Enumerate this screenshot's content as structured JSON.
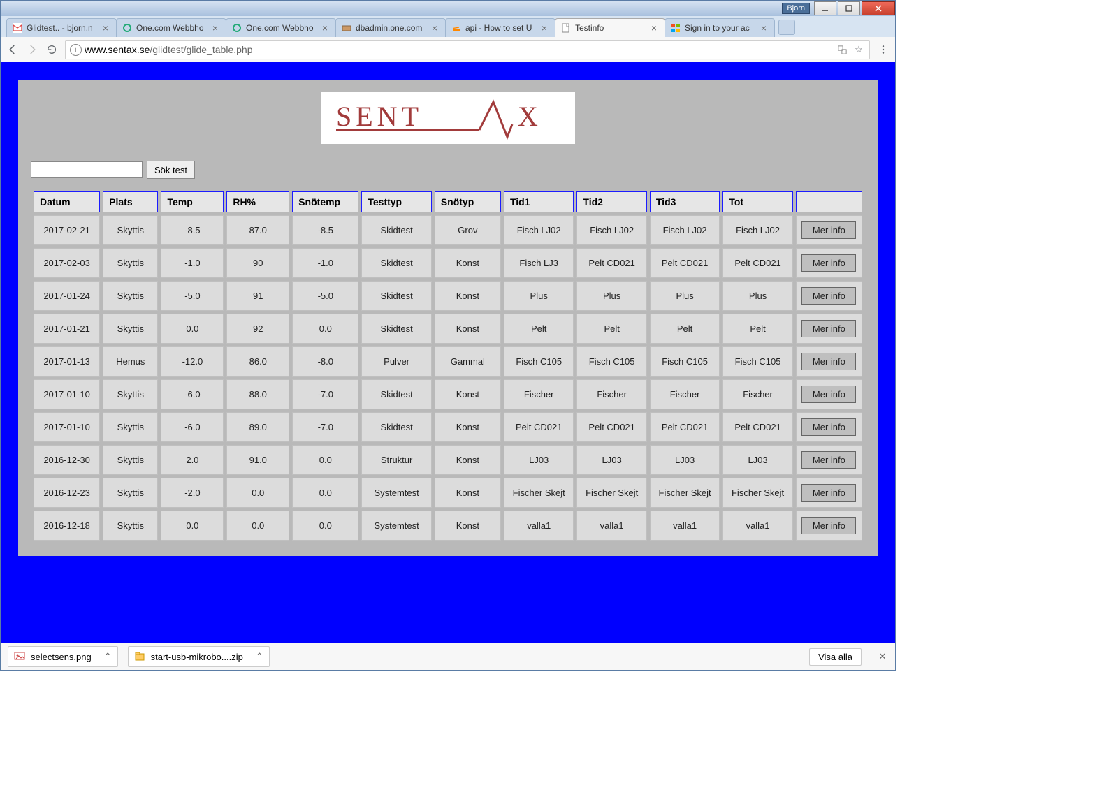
{
  "window": {
    "user_badge": "Bjorn"
  },
  "tabs": [
    {
      "label": "Glidtest.. - bjorn.n",
      "favicon": "gmail"
    },
    {
      "label": "One.com Webbho",
      "favicon": "one"
    },
    {
      "label": "One.com Webbho",
      "favicon": "one"
    },
    {
      "label": "dbadmin.one.com",
      "favicon": "pma"
    },
    {
      "label": "api - How to set U",
      "favicon": "so"
    },
    {
      "label": "Testinfo",
      "favicon": "page",
      "active": true
    },
    {
      "label": "Sign in to your ac",
      "favicon": "ms"
    }
  ],
  "address": {
    "host": "www.sentax.se",
    "path": "/glidtest/glide_table.php"
  },
  "page": {
    "logo_text": "SENTAX",
    "search_placeholder": "",
    "search_button": "Sök test",
    "more_button": "Mer info",
    "headers": [
      "Datum",
      "Plats",
      "Temp",
      "RH%",
      "Snötemp",
      "Testtyp",
      "Snötyp",
      "Tid1",
      "Tid2",
      "Tid3",
      "Tot",
      ""
    ],
    "rows": [
      {
        "datum": "2017-02-21",
        "plats": "Skyttis",
        "temp": "-8.5",
        "rh": "87.0",
        "snotemp": "-8.5",
        "testtyp": "Skidtest",
        "snotyp": "Grov",
        "t1": "Fisch LJ02",
        "t2": "Fisch LJ02",
        "t3": "Fisch LJ02",
        "tot": "Fisch LJ02"
      },
      {
        "datum": "2017-02-03",
        "plats": "Skyttis",
        "temp": "-1.0",
        "rh": "90",
        "snotemp": "-1.0",
        "testtyp": "Skidtest",
        "snotyp": "Konst",
        "t1": "Fisch LJ3",
        "t2": "Pelt CD021",
        "t3": "Pelt CD021",
        "tot": "Pelt CD021"
      },
      {
        "datum": "2017-01-24",
        "plats": "Skyttis",
        "temp": "-5.0",
        "rh": "91",
        "snotemp": "-5.0",
        "testtyp": "Skidtest",
        "snotyp": "Konst",
        "t1": "Plus",
        "t2": "Plus",
        "t3": "Plus",
        "tot": "Plus"
      },
      {
        "datum": "2017-01-21",
        "plats": "Skyttis",
        "temp": "0.0",
        "rh": "92",
        "snotemp": "0.0",
        "testtyp": "Skidtest",
        "snotyp": "Konst",
        "t1": "Pelt",
        "t2": "Pelt",
        "t3": "Pelt",
        "tot": "Pelt"
      },
      {
        "datum": "2017-01-13",
        "plats": "Hemus",
        "temp": "-12.0",
        "rh": "86.0",
        "snotemp": "-8.0",
        "testtyp": "Pulver",
        "snotyp": "Gammal",
        "t1": "Fisch C105",
        "t2": "Fisch C105",
        "t3": "Fisch C105",
        "tot": "Fisch C105"
      },
      {
        "datum": "2017-01-10",
        "plats": "Skyttis",
        "temp": "-6.0",
        "rh": "88.0",
        "snotemp": "-7.0",
        "testtyp": "Skidtest",
        "snotyp": "Konst",
        "t1": "Fischer",
        "t2": "Fischer",
        "t3": "Fischer",
        "tot": "Fischer"
      },
      {
        "datum": "2017-01-10",
        "plats": "Skyttis",
        "temp": "-6.0",
        "rh": "89.0",
        "snotemp": "-7.0",
        "testtyp": "Skidtest",
        "snotyp": "Konst",
        "t1": "Pelt CD021",
        "t2": "Pelt CD021",
        "t3": "Pelt CD021",
        "tot": "Pelt CD021"
      },
      {
        "datum": "2016-12-30",
        "plats": "Skyttis",
        "temp": "2.0",
        "rh": "91.0",
        "snotemp": "0.0",
        "testtyp": "Struktur",
        "snotyp": "Konst",
        "t1": "LJ03",
        "t2": "LJ03",
        "t3": "LJ03",
        "tot": "LJ03"
      },
      {
        "datum": "2016-12-23",
        "plats": "Skyttis",
        "temp": "-2.0",
        "rh": "0.0",
        "snotemp": "0.0",
        "testtyp": "Systemtest",
        "snotyp": "Konst",
        "t1": "Fischer Skejt",
        "t2": "Fischer Skejt",
        "t3": "Fischer Skejt",
        "tot": "Fischer Skejt"
      },
      {
        "datum": "2016-12-18",
        "plats": "Skyttis",
        "temp": "0.0",
        "rh": "0.0",
        "snotemp": "0.0",
        "testtyp": "Systemtest",
        "snotyp": "Konst",
        "t1": "valla1",
        "t2": "valla1",
        "t3": "valla1",
        "tot": "valla1"
      }
    ]
  },
  "downloads": {
    "items": [
      {
        "name": "selectsens.png",
        "icon": "img"
      },
      {
        "name": "start-usb-mikrobo....zip",
        "icon": "zip"
      }
    ],
    "show_all": "Visa alla"
  }
}
